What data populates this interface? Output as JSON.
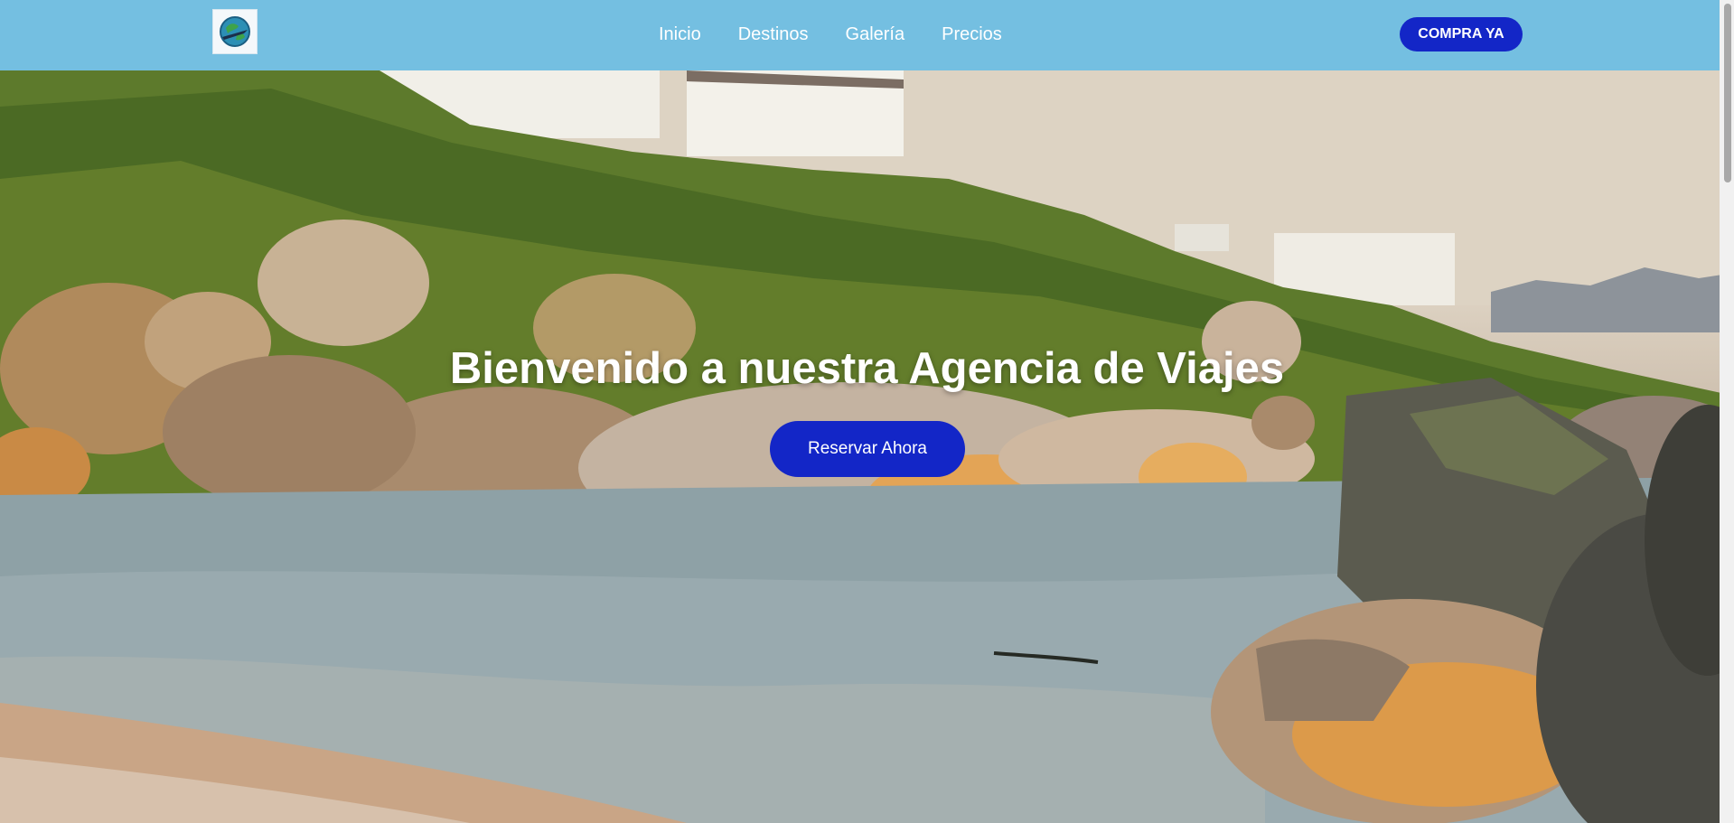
{
  "header": {
    "logo_icon": "globe-plane-icon",
    "nav": [
      {
        "label": "Inicio"
      },
      {
        "label": "Destinos"
      },
      {
        "label": "Galería"
      },
      {
        "label": "Precios"
      }
    ],
    "buy_label": "COMPRA YA"
  },
  "hero": {
    "title": "Bienvenido a nuestra Agencia de Viajes",
    "cta_label": "Reservar Ahora"
  },
  "colors": {
    "header_bg": "#74bfe1",
    "accent": "#1326c7",
    "text_light": "#ffffff"
  }
}
